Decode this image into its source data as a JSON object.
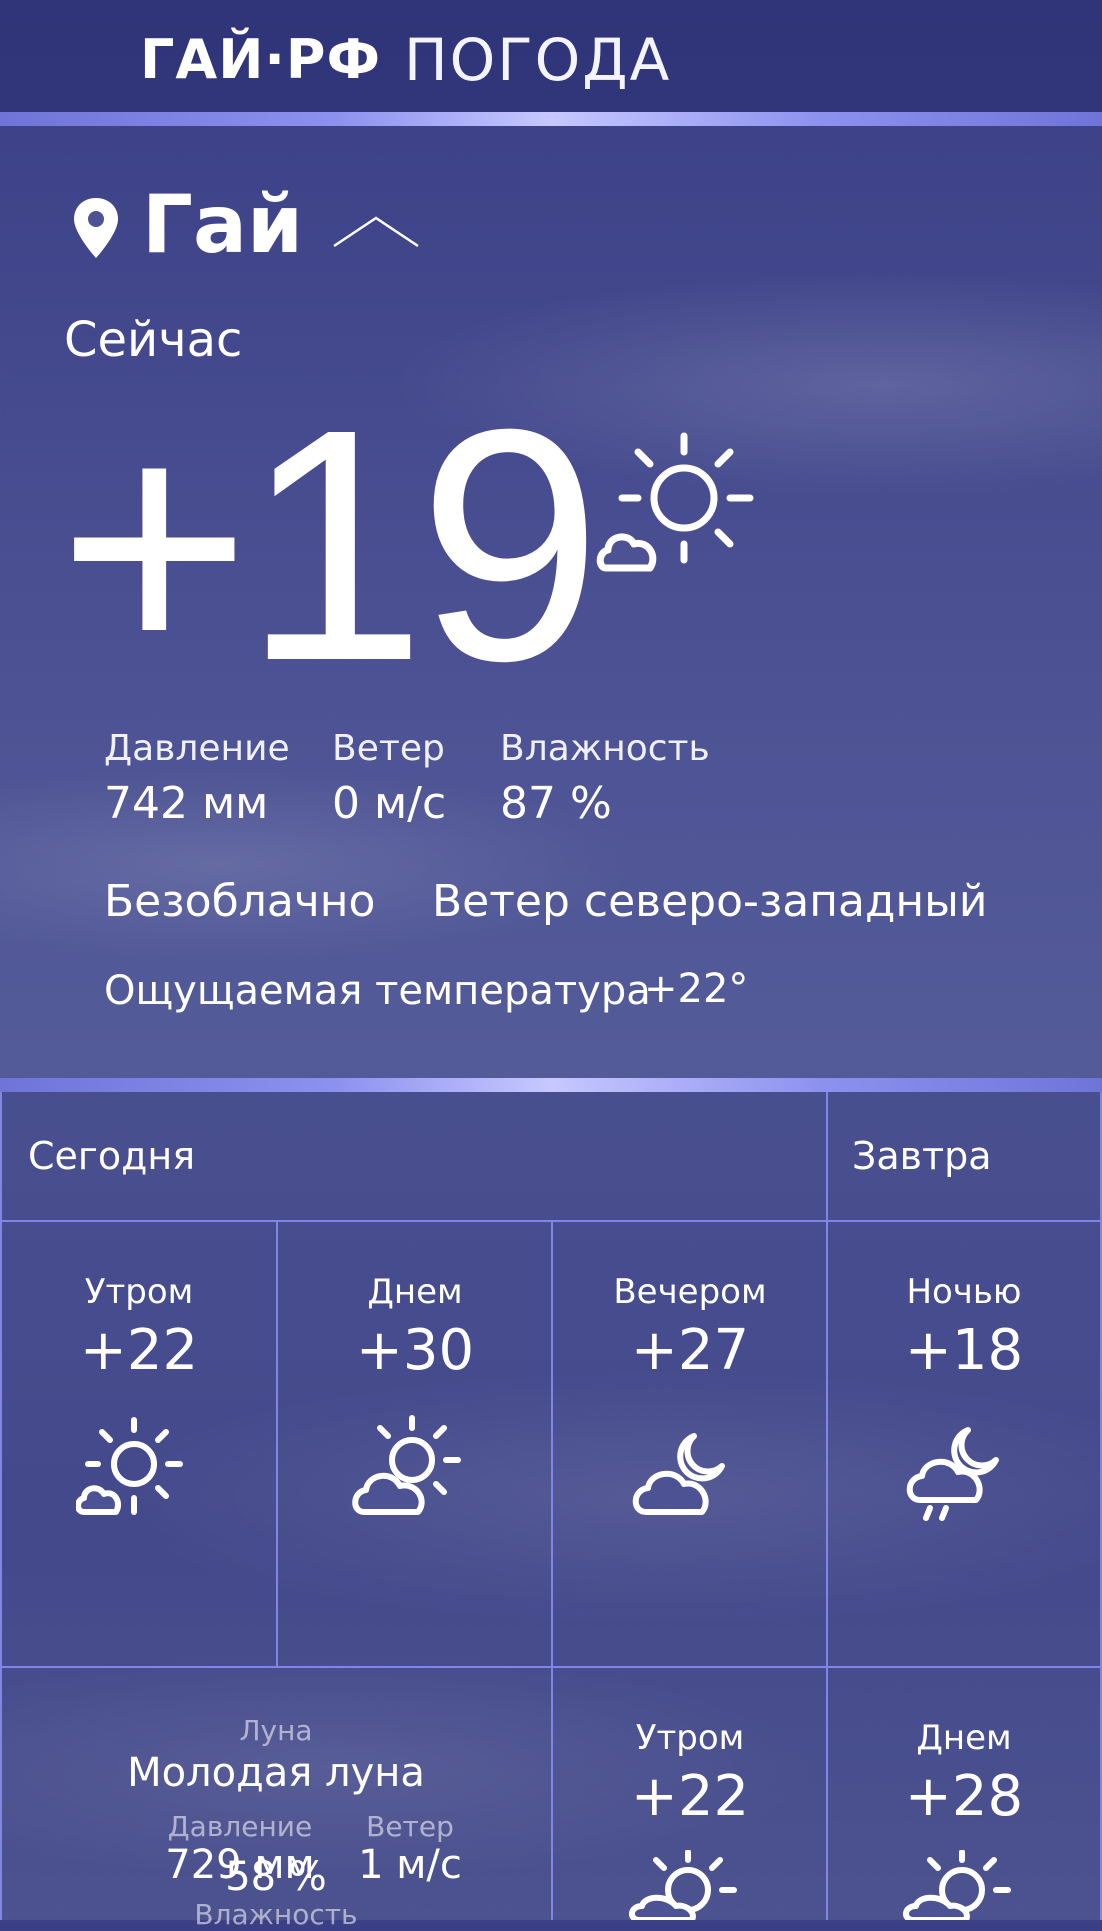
{
  "header": {
    "brand": "ГАЙ·РФ",
    "section": "ПОГОДА"
  },
  "location": {
    "city": "Гай",
    "pin_icon": "location-pin-icon",
    "toggle_icon": "chevron-up-icon"
  },
  "current": {
    "label": "Сейчас",
    "temperature": "+19",
    "icon": "sun-behind-cloud-icon",
    "stats": [
      {
        "label": "Давление",
        "value": "742 мм"
      },
      {
        "label": "Ветер",
        "value": "0 м/с"
      },
      {
        "label": "Влажность",
        "value": "87 %"
      }
    ],
    "condition": "Безоблачно",
    "wind_direction": "Ветер северо-западный",
    "feels_label": "Ощущаемая температура",
    "feels_value": "+22°"
  },
  "forecast": {
    "today_label": "Сегодня",
    "tomorrow_label": "Завтра",
    "today": [
      {
        "period": "Утром",
        "temp": "+22",
        "icon": "sun-behind-small-cloud-icon"
      },
      {
        "period": "Днем",
        "temp": "+30",
        "icon": "cloud-sun-icon"
      },
      {
        "period": "Вечером",
        "temp": "+27",
        "icon": "cloud-moon-icon"
      },
      {
        "period": "Ночью",
        "temp": "+18",
        "icon": "cloud-moon-rain-icon"
      }
    ],
    "tomorrow": [
      {
        "period": "Утром",
        "temp": "+22",
        "icon": "cloud-sun-icon"
      },
      {
        "period": "Днем",
        "temp": "+28",
        "icon": "cloud-sun-icon"
      }
    ]
  },
  "moon": {
    "label": "Луна",
    "phase": "Молодая луна",
    "pressure_label": "Давление",
    "pressure_value": "729 мм",
    "wind_label": "Ветер",
    "wind_value": "1 м/с",
    "humidity_label": "Влажность",
    "humidity_value": "58 %"
  },
  "colors": {
    "line": "#7f86e8",
    "glow": "#c6c8ff",
    "text": "#ffffff"
  }
}
